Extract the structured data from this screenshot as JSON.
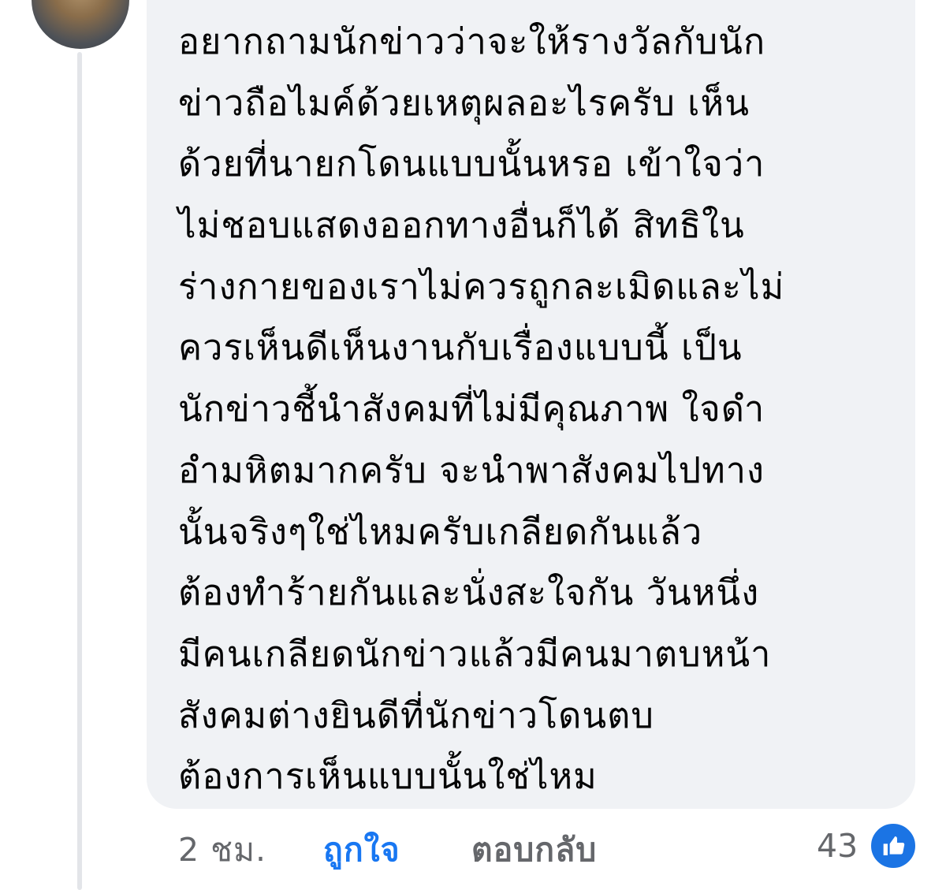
{
  "comment": {
    "lines": [
      "อยากถามนักข่าวว่าจะให้รางวัลกับนัก",
      "ข่าวถือไมค์ด้วยเหตุผลอะไรครับ เห็น",
      "ด้วยที่นายกโดนแบบนั้นหรอ เข้าใจว่า",
      "ไม่ชอบแสดงออกทางอื่นก็ได้ สิทธิใน",
      "ร่างกายของเราไม่ควรถูกละเมิดและไม่",
      "ควรเห็นดีเห็นงานกับเรื่องแบบนี้ เป็น",
      "นักข่าวชี้นำสังคมที่ไม่มีคุณภาพ ใจดำ",
      "อำมหิตมากครับ จะนำพาสังคมไปทาง",
      "นั้นจริงๆใช่ไหมครับเกลียดกันแล้ว",
      "ต้องทำร้ายกันและนั่งสะใจกัน วันหนึ่ง",
      "มีคนเกลียดนักข่าวแล้วมีคนมาตบหน้า",
      "สังคมต่างยินดีที่นักข่าวโดนตบ",
      "ต้องการเห็นแบบนั้นใช่ไหม"
    ],
    "time": "2 ชม.",
    "like_label": "ถูกใจ",
    "reply_label": "ตอบกลับ",
    "reaction_count": "43",
    "reaction_icon": "thumbs-up-icon"
  },
  "colors": {
    "bubble_bg": "#f0f2f5",
    "like_active": "#1877f2",
    "meta_text": "#65676b",
    "reaction_badge": "#1b74e4"
  }
}
